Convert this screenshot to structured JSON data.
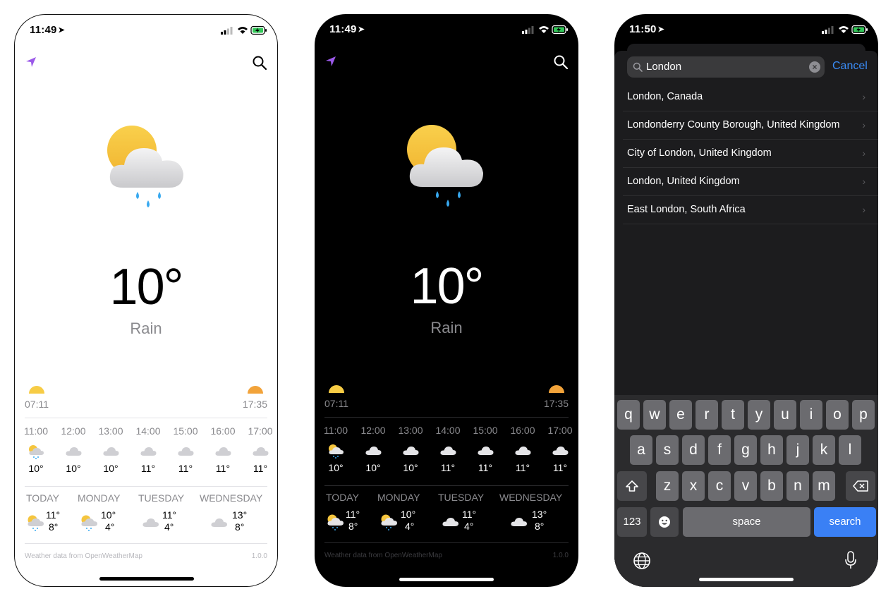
{
  "colors": {
    "accent_purple": "#9b59e9",
    "search_blue": "#3a80f5",
    "cancel_blue": "#3a8cf7",
    "sunrise": "#f7cc45",
    "sunset": "#f2a33a",
    "rain_drop": "#38a9f0"
  },
  "screens": [
    {
      "theme": "light",
      "status": {
        "time": "11:49"
      },
      "current": {
        "temperature": "10°",
        "condition": "Rain",
        "icon": "sun-cloud-rain-icon"
      },
      "sun": {
        "sunrise": "07:11",
        "sunset": "17:35"
      },
      "hourly": [
        {
          "time": "11:00",
          "temp": "10°",
          "icon": "sun-cloud-rain-icon"
        },
        {
          "time": "12:00",
          "temp": "10°",
          "icon": "cloud-icon"
        },
        {
          "time": "13:00",
          "temp": "10°",
          "icon": "cloud-icon"
        },
        {
          "time": "14:00",
          "temp": "11°",
          "icon": "cloud-icon"
        },
        {
          "time": "15:00",
          "temp": "11°",
          "icon": "cloud-icon"
        },
        {
          "time": "16:00",
          "temp": "11°",
          "icon": "cloud-icon"
        },
        {
          "time": "17:00",
          "temp": "11°",
          "icon": "cloud-icon"
        }
      ],
      "daily": [
        {
          "day": "TODAY",
          "high": "11°",
          "low": "8°",
          "icon": "sun-cloud-rain-icon"
        },
        {
          "day": "MONDAY",
          "high": "10°",
          "low": "4°",
          "icon": "sun-cloud-rain-icon"
        },
        {
          "day": "TUESDAY",
          "high": "11°",
          "low": "4°",
          "icon": "cloud-icon"
        },
        {
          "day": "WEDNESDAY",
          "high": "13°",
          "low": "8°",
          "icon": "cloud-icon"
        }
      ],
      "footer": {
        "credit": "Weather data from OpenWeatherMap",
        "version": "1.0.0"
      }
    },
    {
      "theme": "dark",
      "status": {
        "time": "11:49"
      },
      "current": {
        "temperature": "10°",
        "condition": "Rain",
        "icon": "sun-cloud-rain-icon"
      },
      "sun": {
        "sunrise": "07:11",
        "sunset": "17:35"
      },
      "hourly": [
        {
          "time": "11:00",
          "temp": "10°",
          "icon": "sun-cloud-rain-icon"
        },
        {
          "time": "12:00",
          "temp": "10°",
          "icon": "cloud-icon"
        },
        {
          "time": "13:00",
          "temp": "10°",
          "icon": "cloud-icon"
        },
        {
          "time": "14:00",
          "temp": "11°",
          "icon": "cloud-icon"
        },
        {
          "time": "15:00",
          "temp": "11°",
          "icon": "cloud-icon"
        },
        {
          "time": "16:00",
          "temp": "11°",
          "icon": "cloud-icon"
        },
        {
          "time": "17:00",
          "temp": "11°",
          "icon": "cloud-icon"
        }
      ],
      "daily": [
        {
          "day": "TODAY",
          "high": "11°",
          "low": "8°",
          "icon": "sun-cloud-rain-icon"
        },
        {
          "day": "MONDAY",
          "high": "10°",
          "low": "4°",
          "icon": "sun-cloud-rain-icon"
        },
        {
          "day": "TUESDAY",
          "high": "11°",
          "low": "4°",
          "icon": "cloud-icon"
        },
        {
          "day": "WEDNESDAY",
          "high": "13°",
          "low": "8°",
          "icon": "cloud-icon"
        }
      ],
      "footer": {
        "credit": "Weather data from OpenWeatherMap",
        "version": "1.0.0"
      }
    }
  ],
  "search_screen": {
    "status": {
      "time": "11:50"
    },
    "query": "London",
    "cancel_label": "Cancel",
    "results": [
      "London, Canada",
      "Londonderry County Borough, United Kingdom",
      "City of London, United Kingdom",
      "London, United Kingdom",
      "East London, South Africa"
    ],
    "keyboard": {
      "row1": [
        "q",
        "w",
        "e",
        "r",
        "t",
        "y",
        "u",
        "i",
        "o",
        "p"
      ],
      "row2": [
        "a",
        "s",
        "d",
        "f",
        "g",
        "h",
        "j",
        "k",
        "l"
      ],
      "row3": [
        "z",
        "x",
        "c",
        "v",
        "b",
        "n",
        "m"
      ],
      "numbers_label": "123",
      "space_label": "space",
      "action_label": "search"
    }
  }
}
